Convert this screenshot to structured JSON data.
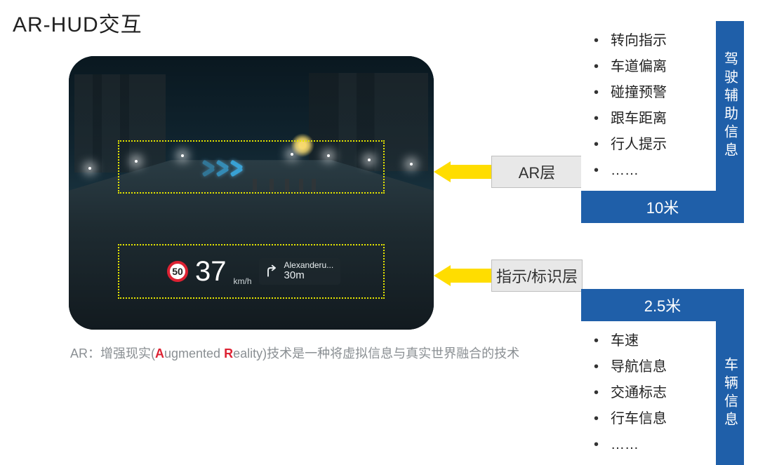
{
  "title": "AR-HUD交互",
  "ar_zone": {
    "label": "AR层",
    "distance": "10米"
  },
  "indicator_zone": {
    "label": "指示/标识层",
    "distance": "2.5米"
  },
  "hud": {
    "speed_limit": "50",
    "speed_value": "37",
    "speed_unit": "km/h",
    "nav_destination": "Alexanderu...",
    "nav_distance": "30m"
  },
  "right": {
    "adas": {
      "title": "驾驶辅助信息",
      "items": [
        "转向指示",
        "车道偏离",
        "碰撞预警",
        "跟车距离",
        "行人提示",
        "……"
      ]
    },
    "vehicle": {
      "title": "车辆信息",
      "items": [
        "车速",
        "导航信息",
        "交通标志",
        "行车信息",
        "……"
      ]
    }
  },
  "caption": {
    "prefix": "AR：增强现实(",
    "a_letter": "A",
    "a_rest": "ugmented ",
    "r_letter": "R",
    "r_rest": "eality)技术是一种将虚拟信息与真实世界融合的技术"
  }
}
